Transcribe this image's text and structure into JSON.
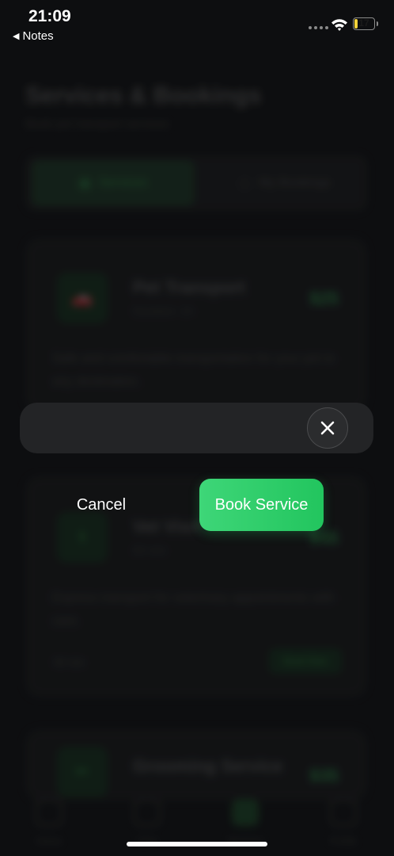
{
  "status_bar": {
    "time": "21:09",
    "back_label": "Notes",
    "battery_level": "17",
    "battery_fraction": 0.17,
    "battery_color": "#f2d23a"
  },
  "background_app": {
    "title": "Services & Bookings",
    "subtitle": "Book pet transport services",
    "tabs": [
      {
        "label": "Services",
        "icon": "grid-icon",
        "active": true
      },
      {
        "label": "My Bookings",
        "icon": "calendar-icon",
        "active": false
      }
    ],
    "services": [
      {
        "icon": "car-icon",
        "icon_glyph": "🚗",
        "name": "Pet Transport",
        "duration": "Duration: 1h",
        "price": "$25",
        "description": "Safe and comfortable transportation for your pet to any destination."
      },
      {
        "icon": "stethoscope-icon",
        "icon_glyph": "⚕",
        "name": "Vet Visit",
        "duration": "90 min",
        "price": "$45",
        "description": "Express transport for veterinary appointments with care.",
        "time": "90 min",
        "button": "Book Now"
      },
      {
        "icon": "scissors-icon",
        "icon_glyph": "✂",
        "name": "Grooming Service",
        "price": "$35"
      }
    ],
    "bottom_nav": [
      {
        "label": "Home",
        "icon": "home-icon",
        "active": false
      },
      {
        "label": "Chat",
        "icon": "chat-icon",
        "active": false
      },
      {
        "label": "Services",
        "icon": "services-icon",
        "active": true
      },
      {
        "label": "Profile",
        "icon": "profile-icon",
        "active": false
      }
    ]
  },
  "modal": {
    "close_icon": "close-icon",
    "cancel_label": "Cancel",
    "book_label": "Book Service",
    "accent_color": "#22c55e"
  }
}
